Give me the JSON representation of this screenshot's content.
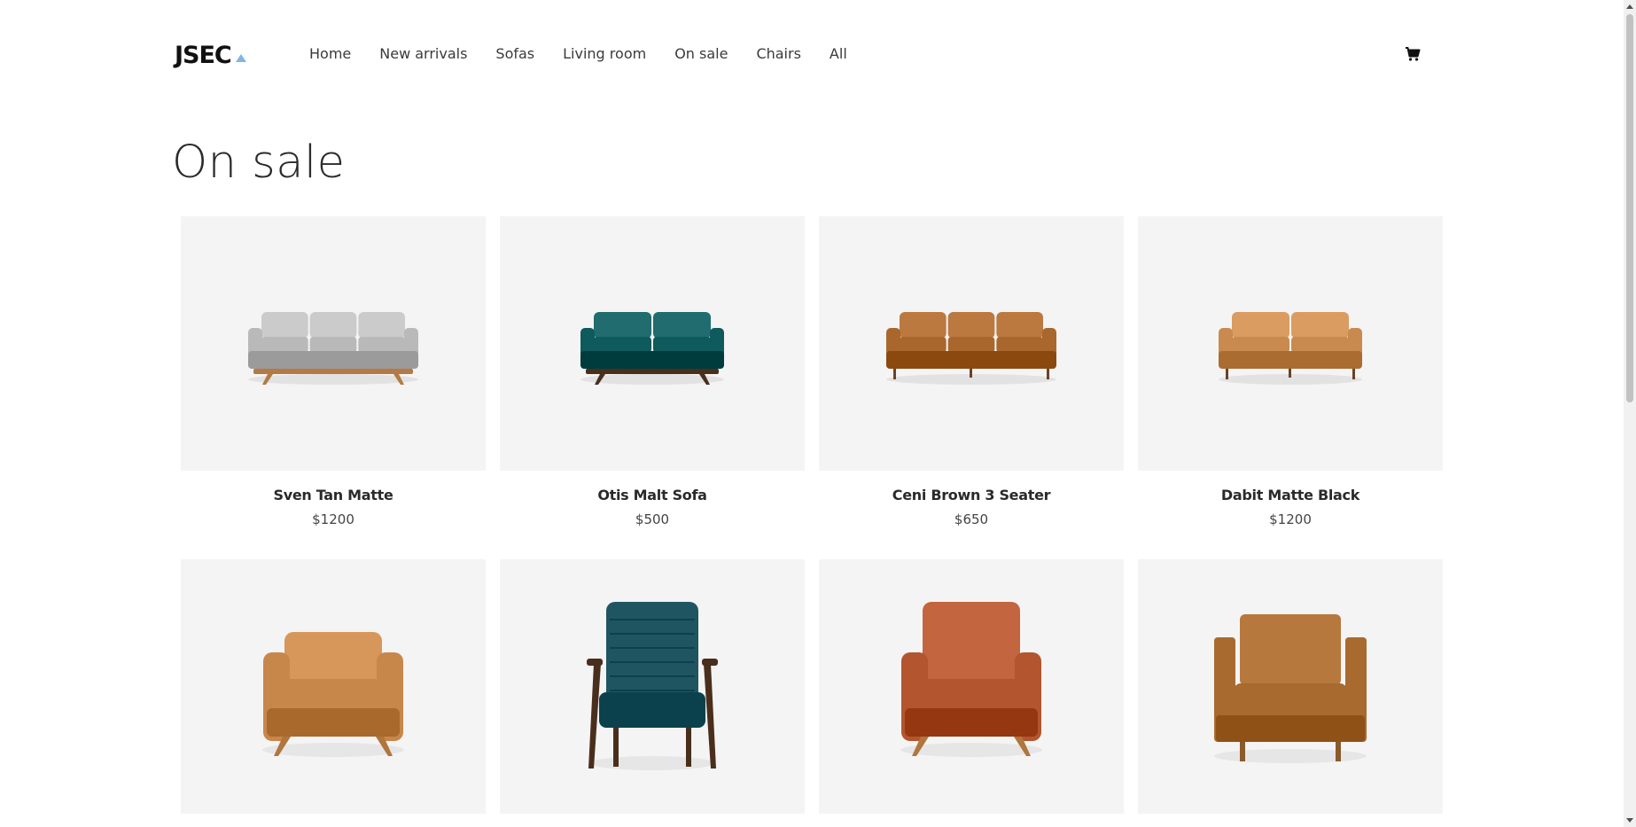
{
  "brand": {
    "logo_text": "JSEC",
    "accent": "#7fb6e6"
  },
  "nav": {
    "items": [
      "Home",
      "New arrivals",
      "Sofas",
      "Living room",
      "On sale",
      "Chairs",
      "All"
    ]
  },
  "header": {
    "cart_icon": "shopping-cart-icon"
  },
  "page": {
    "title": "On sale"
  },
  "products": [
    {
      "name": "Sven Tan Matte",
      "price": "$1200",
      "kind": "sofa-3",
      "color": "#b9b9b9"
    },
    {
      "name": "Otis Malt Sofa",
      "price": "$500",
      "kind": "sofa-2",
      "color": "#0e5a5c"
    },
    {
      "name": "Ceni Brown 3 Seater",
      "price": "$650",
      "kind": "sofa-3",
      "color": "#a9672e"
    },
    {
      "name": "Dabit Matte Black",
      "price": "$1200",
      "kind": "sofa-2b",
      "color": "#c98a4f"
    },
    {
      "name": "",
      "price": "",
      "kind": "armchair",
      "color": "#c8874a"
    },
    {
      "name": "",
      "price": "",
      "kind": "lounge",
      "color": "#1f5561"
    },
    {
      "name": "",
      "price": "",
      "kind": "armchair-tall",
      "color": "#b3552f"
    },
    {
      "name": "",
      "price": "",
      "kind": "armchair-box",
      "color": "#a86a2f"
    }
  ]
}
